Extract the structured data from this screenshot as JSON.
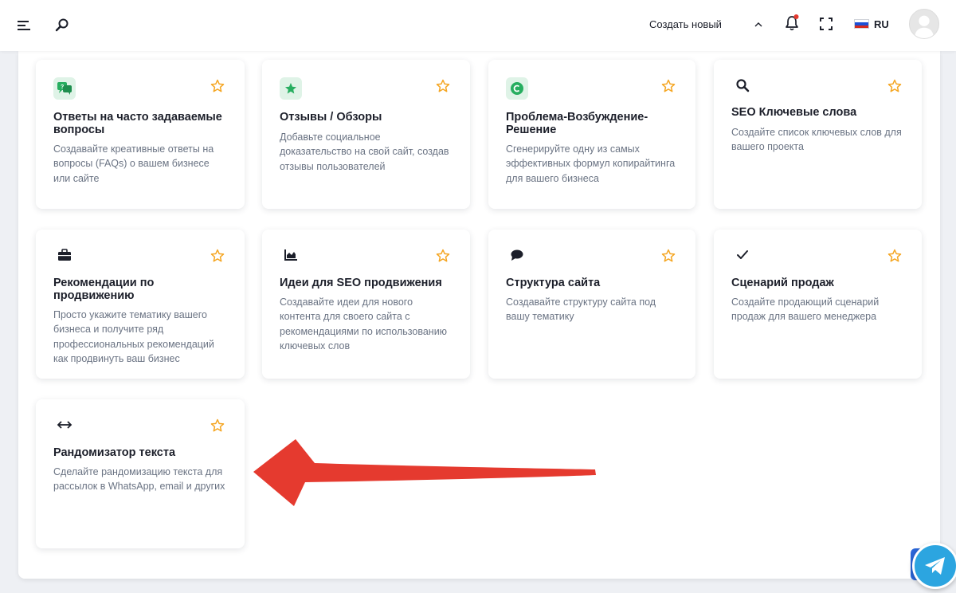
{
  "header": {
    "create_new_label": "Создать новый",
    "language": "RU",
    "icons": [
      "menu-icon",
      "search-icon",
      "chevron-up-icon",
      "bell-icon",
      "fullscreen-icon",
      "avatar"
    ]
  },
  "cards": [
    {
      "title": "Ответы на часто задаваемые вопросы",
      "description": "Создавайте креативные ответы на вопросы (FAQs) о вашем бизнесе или сайте",
      "icon": "faq-icon"
    },
    {
      "title": "Отзывы / Обзоры",
      "description": "Добавьте социальное доказательство на свой сайт, создав отзывы пользователей",
      "icon": "review-star-icon"
    },
    {
      "title": "Проблема-Возбуждение-Решение",
      "description": "Сгенерируйте одну из самых эффективных формул копирайтинга для вашего бизнеса",
      "icon": "copyright-icon"
    },
    {
      "title": "SEO Ключевые слова",
      "description": "Создайте список ключевых слов для вашего проекта",
      "icon": "search-icon"
    },
    {
      "title": "Рекомендации по продвижению",
      "description": "Просто укажите тематику вашего бизнеса и получите ряд профессиональных рекомендаций как продвинуть ваш бизнес",
      "icon": "briefcase-icon"
    },
    {
      "title": "Идеи для SEO продвижения",
      "description": "Создавайте идеи для нового контента для своего сайта с рекомендациями по использованию ключевых слов",
      "icon": "chart-icon"
    },
    {
      "title": "Структура сайта",
      "description": "Создавайте структуру сайта под вашу тематику",
      "icon": "chat-bubble-icon"
    },
    {
      "title": "Сценарий продаж",
      "description": "Создайте продающий сценарий продаж для вашего менеджера",
      "icon": "checkmark-icon"
    },
    {
      "title": "Рандомизатор текста",
      "description": "Сделайте рандомизацию текста для рассылок в WhatsApp, email и других",
      "icon": "arrows-horizontal-icon"
    }
  ],
  "colors": {
    "accent_green": "#27ae60",
    "star": "#f5a623",
    "arrow_red": "#e53a2f",
    "telegram": "#2ca5e0",
    "flag": [
      "#ffffff",
      "#1c4fd6",
      "#d52b1e"
    ]
  }
}
